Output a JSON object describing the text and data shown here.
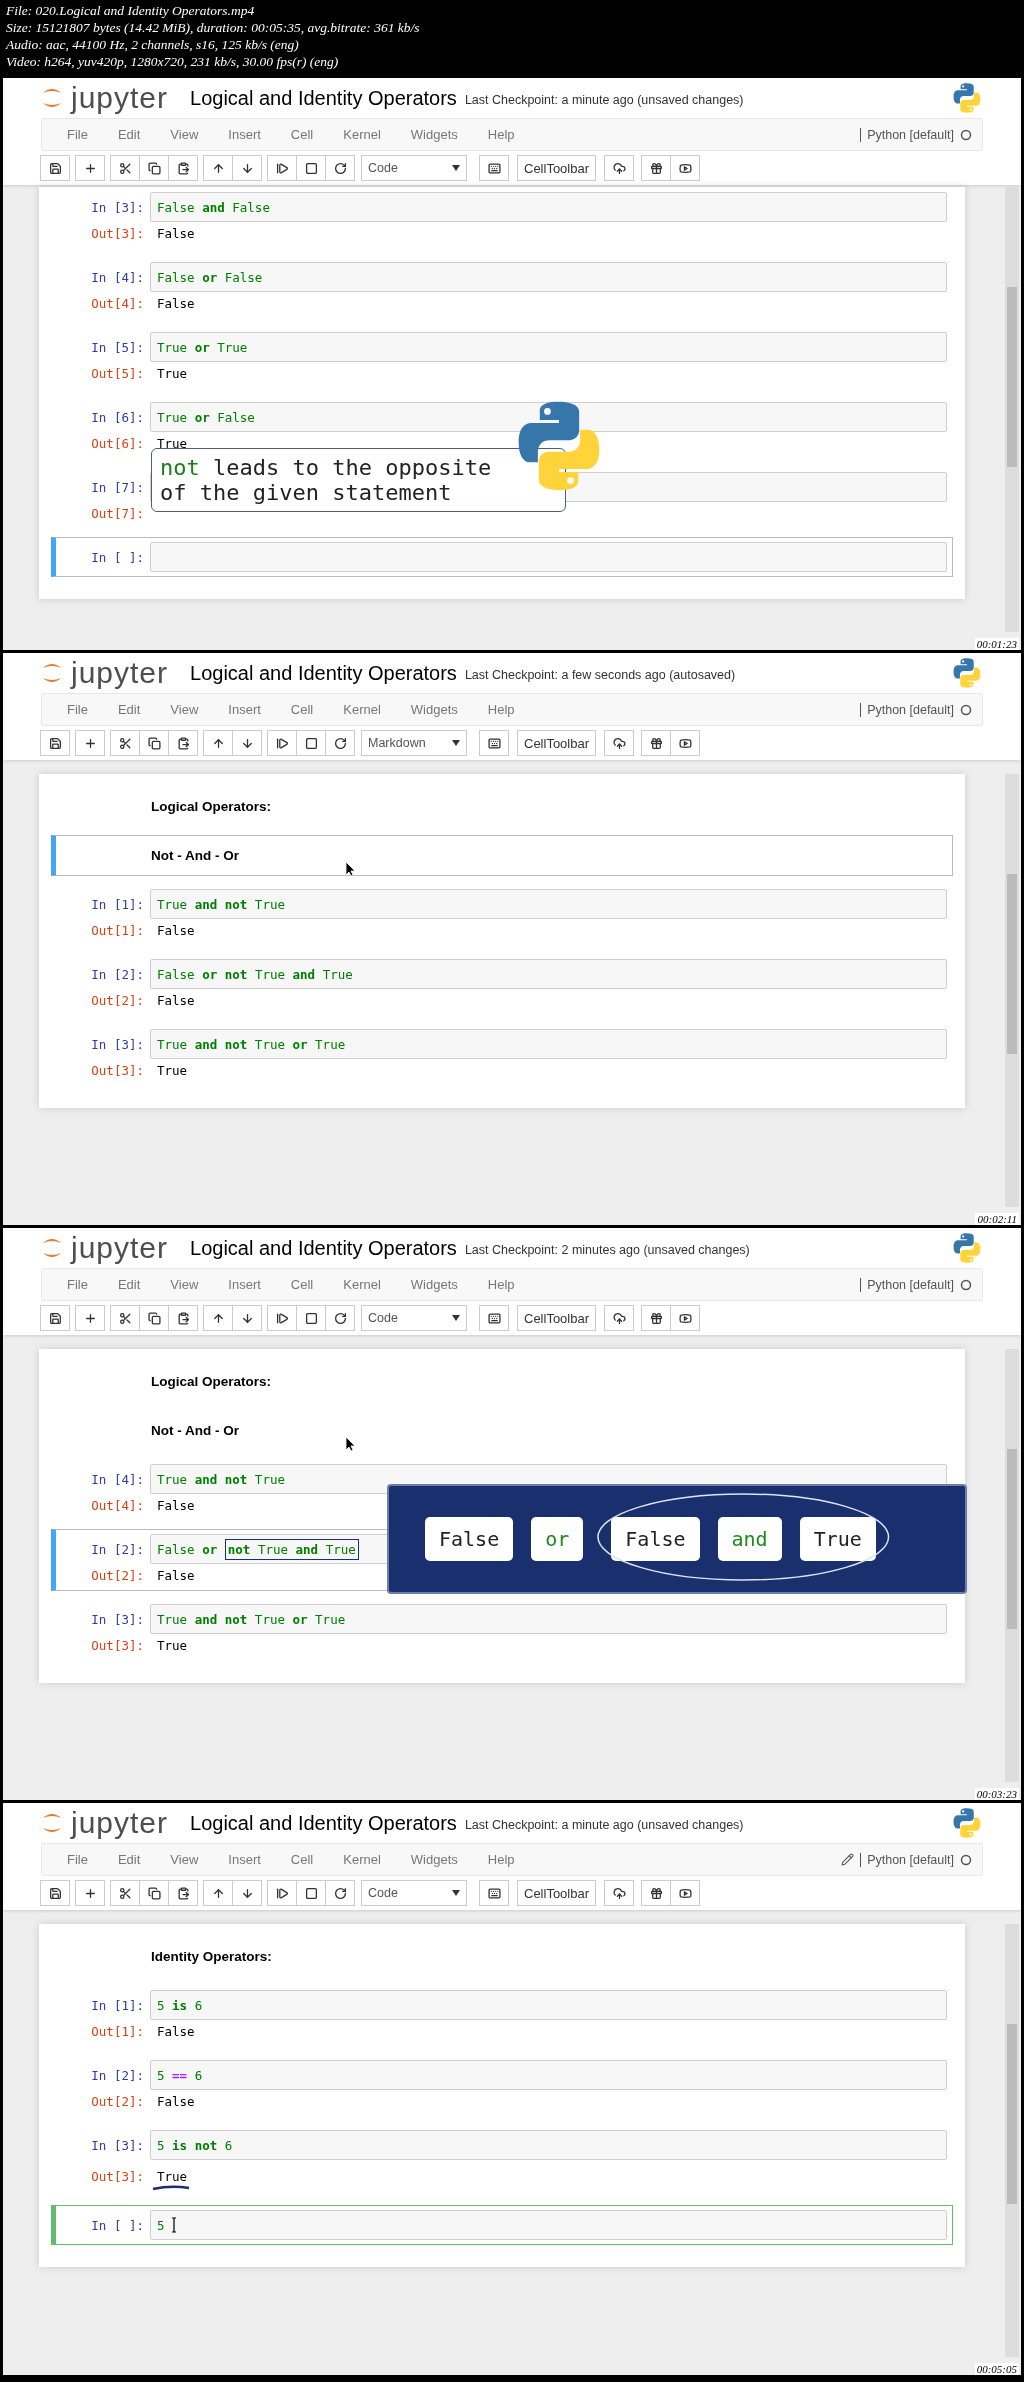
{
  "file_info": [
    "File: 020.Logical and Identity Operators.mp4",
    "Size: 15121807 bytes (14.42 MiB), duration: 00:05:35, avg.bitrate: 361 kb/s",
    "Audio: aac, 44100 Hz, 2 channels, s16, 125 kb/s (eng)",
    "Video: h264, yuv420p, 1280x720, 231 kb/s, 30.00 fps(r) (eng)"
  ],
  "frames": [
    {
      "logo_text": "jupyter",
      "title": "Logical and Identity Operators",
      "checkpoint": "Last Checkpoint: a minute ago (unsaved changes)",
      "menu": [
        "File",
        "Edit",
        "View",
        "Insert",
        "Cell",
        "Kernel",
        "Widgets",
        "Help"
      ],
      "editing": false,
      "kernel": "Python [default]",
      "cell_type": "Code",
      "cell_toolbar": "CellToolbar",
      "timestamp": "00:01:23",
      "pointer": false,
      "cells": [
        {
          "kind": "code",
          "prompt_in": "In [3]:",
          "tokens": [
            {
              "text": "False",
              "kind": "literal"
            },
            {
              "text": "and",
              "kind": "keyword"
            },
            {
              "text": "False",
              "kind": "literal"
            }
          ],
          "prompt_out": "Out[3]:",
          "output": "False",
          "selected": false
        },
        {
          "kind": "code",
          "prompt_in": "In [4]:",
          "tokens": [
            {
              "text": "False",
              "kind": "literal"
            },
            {
              "text": "or",
              "kind": "keyword"
            },
            {
              "text": "False",
              "kind": "literal"
            }
          ],
          "prompt_out": "Out[4]:",
          "output": "False",
          "selected": false
        },
        {
          "kind": "code",
          "prompt_in": "In [5]:",
          "tokens": [
            {
              "text": "True",
              "kind": "literal"
            },
            {
              "text": "or",
              "kind": "keyword"
            },
            {
              "text": "True",
              "kind": "literal"
            }
          ],
          "prompt_out": "Out[5]:",
          "output": "True",
          "selected": false
        },
        {
          "kind": "code",
          "prompt_in": "In [6]:",
          "tokens": [
            {
              "text": "True",
              "kind": "literal"
            },
            {
              "text": "or",
              "kind": "keyword"
            },
            {
              "text": "False",
              "kind": "literal"
            }
          ],
          "prompt_out": "Out[6]:",
          "output": "True",
          "selected": false
        },
        {
          "kind": "code",
          "prompt_in": "In [7]:",
          "prompt_out": "Out[7]:",
          "selected": false
        },
        {
          "kind": "code",
          "prompt_in": "In [ ]:",
          "selected": true,
          "edit_mode": false
        }
      ],
      "callout": {
        "text": "**not** leads to the opposite of the given statement"
      }
    },
    {
      "logo_text": "jupyter",
      "title": "Logical and Identity Operators",
      "checkpoint": "Last Checkpoint: a few seconds ago (autosaved)",
      "menu": [
        "File",
        "Edit",
        "View",
        "Insert",
        "Cell",
        "Kernel",
        "Widgets",
        "Help"
      ],
      "editing": false,
      "kernel": "Python [default]",
      "cell_type": "Markdown",
      "cell_toolbar": "CellToolbar",
      "timestamp": "00:02:11",
      "pointer": true,
      "cells": [
        {
          "kind": "heading",
          "text": "Logical Operators:",
          "selected": false
        },
        {
          "kind": "heading",
          "text": "Not - And - Or",
          "selected": true,
          "edit_mode": false
        },
        {
          "kind": "code",
          "prompt_in": "In [1]:",
          "tokens": [
            {
              "text": "True",
              "kind": "literal"
            },
            {
              "text": "and",
              "kind": "keyword"
            },
            {
              "text": "not",
              "kind": "keyword"
            },
            {
              "text": "True",
              "kind": "literal"
            }
          ],
          "prompt_out": "Out[1]:",
          "output": "False",
          "selected": false
        },
        {
          "kind": "code",
          "prompt_in": "In [2]:",
          "tokens": [
            {
              "text": "False",
              "kind": "literal"
            },
            {
              "text": "or",
              "kind": "keyword"
            },
            {
              "text": "not",
              "kind": "keyword"
            },
            {
              "text": "True",
              "kind": "literal"
            },
            {
              "text": "and",
              "kind": "keyword"
            },
            {
              "text": "True",
              "kind": "literal"
            }
          ],
          "prompt_out": "Out[2]:",
          "output": "False",
          "selected": false
        },
        {
          "kind": "code",
          "prompt_in": "In [3]:",
          "tokens": [
            {
              "text": "True",
              "kind": "literal"
            },
            {
              "text": "and",
              "kind": "keyword"
            },
            {
              "text": "not",
              "kind": "keyword"
            },
            {
              "text": "True",
              "kind": "literal"
            },
            {
              "text": "or",
              "kind": "keyword"
            },
            {
              "text": "True",
              "kind": "literal"
            }
          ],
          "prompt_out": "Out[3]:",
          "output": "True",
          "selected": false
        }
      ]
    },
    {
      "logo_text": "jupyter",
      "title": "Logical and Identity Operators",
      "checkpoint": "Last Checkpoint: 2 minutes ago (unsaved changes)",
      "menu": [
        "File",
        "Edit",
        "View",
        "Insert",
        "Cell",
        "Kernel",
        "Widgets",
        "Help"
      ],
      "editing": false,
      "kernel": "Python [default]",
      "cell_type": "Code",
      "cell_toolbar": "CellToolbar",
      "timestamp": "00:03:23",
      "pointer": true,
      "cells": [
        {
          "kind": "heading",
          "text": "Logical Operators:",
          "selected": false
        },
        {
          "kind": "heading",
          "text": "Not - And - Or",
          "selected": false
        },
        {
          "kind": "code",
          "prompt_in": "In [4]:",
          "tokens": [
            {
              "text": "True",
              "kind": "literal"
            },
            {
              "text": "and",
              "kind": "keyword"
            },
            {
              "text": "not",
              "kind": "keyword"
            },
            {
              "text": "True",
              "kind": "literal"
            }
          ],
          "prompt_out": "Out[4]:",
          "output": "False",
          "selected": false
        },
        {
          "kind": "code",
          "prompt_in": "In [2]:",
          "tokens": [
            {
              "text": "False",
              "kind": "literal",
              "boxed": false
            },
            {
              "text": "or",
              "kind": "keyword",
              "boxed": false
            },
            {
              "text": "not",
              "kind": "keyword",
              "boxed": true
            },
            {
              "text": "True",
              "kind": "literal",
              "boxed": true
            },
            {
              "text": "and",
              "kind": "keyword",
              "boxed": true
            },
            {
              "text": "True",
              "kind": "literal",
              "boxed": true
            }
          ],
          "prompt_out": "Out[2]:",
          "output": "False",
          "selected": true,
          "edit_mode": false
        },
        {
          "kind": "code",
          "prompt_in": "In [3]:",
          "tokens": [
            {
              "text": "True",
              "kind": "literal"
            },
            {
              "text": "and",
              "kind": "keyword"
            },
            {
              "text": "not",
              "kind": "keyword"
            },
            {
              "text": "True",
              "kind": "literal"
            },
            {
              "text": "or",
              "kind": "keyword"
            },
            {
              "text": "True",
              "kind": "literal"
            }
          ],
          "prompt_out": "Out[3]:",
          "output": "True",
          "selected": false
        }
      ],
      "expression_panel": {
        "tokens": [
          {
            "text": "False",
            "kind": "literal",
            "circled": false
          },
          {
            "text": "or",
            "kind": "keyword",
            "circled": false
          },
          {
            "text": "False",
            "kind": "literal",
            "circled": true
          },
          {
            "text": "and",
            "kind": "keyword",
            "circled": true
          },
          {
            "text": "True",
            "kind": "literal",
            "circled": true
          }
        ]
      }
    },
    {
      "logo_text": "jupyter",
      "title": "Logical and Identity Operators",
      "checkpoint": "Last Checkpoint: a minute ago (unsaved changes)",
      "menu": [
        "File",
        "Edit",
        "View",
        "Insert",
        "Cell",
        "Kernel",
        "Widgets",
        "Help"
      ],
      "editing": true,
      "kernel": "Python [default]",
      "cell_type": "Code",
      "cell_toolbar": "CellToolbar",
      "timestamp": "00:05:05",
      "pointer": false,
      "cells": [
        {
          "kind": "heading",
          "text": "Identity Operators:",
          "selected": false
        },
        {
          "kind": "code",
          "prompt_in": "In [1]:",
          "tokens": [
            {
              "text": "5",
              "kind": "number"
            },
            {
              "text": "is",
              "kind": "keyword"
            },
            {
              "text": "6",
              "kind": "number"
            }
          ],
          "prompt_out": "Out[1]:",
          "output": "False",
          "selected": false
        },
        {
          "kind": "code",
          "prompt_in": "In [2]:",
          "tokens": [
            {
              "text": "5",
              "kind": "number"
            },
            {
              "text": "==",
              "kind": "operator"
            },
            {
              "text": "6",
              "kind": "number"
            }
          ],
          "prompt_out": "Out[2]:",
          "output": "False",
          "selected": false
        },
        {
          "kind": "code",
          "prompt_in": "In [3]:",
          "tokens": [
            {
              "text": "5",
              "kind": "number"
            },
            {
              "text": "is",
              "kind": "keyword"
            },
            {
              "text": "not",
              "kind": "keyword"
            },
            {
              "text": "6",
              "kind": "number"
            }
          ],
          "prompt_out": "Out[3]:",
          "output": "True",
          "underlined": true,
          "selected": false
        },
        {
          "kind": "code",
          "prompt_in": "In [ ]:",
          "tokens": [
            {
              "text": "5",
              "kind": "number"
            }
          ],
          "typing": true,
          "selected": true,
          "edit_mode": true
        }
      ]
    }
  ]
}
